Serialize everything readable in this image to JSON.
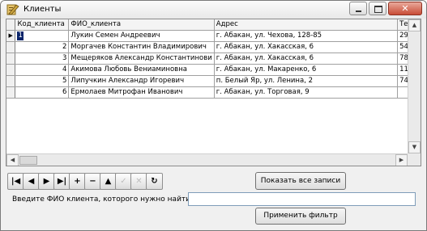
{
  "window": {
    "title": "Клиенты",
    "close_glyph": "✕"
  },
  "grid": {
    "current_pointer": "▶",
    "columns": [
      "Код_клиента",
      "ФИО_клиента",
      "Адрес",
      "Те"
    ],
    "rows": [
      {
        "id": "1",
        "name": "Лукин Семен Андреевич",
        "address": "г. Абакан, ул. Чехова, 128-85",
        "phone": "29"
      },
      {
        "id": "2",
        "name": "Моргачев Константин Владимирович",
        "address": "г. Абакан, ул. Хакасская, 6",
        "phone": "54"
      },
      {
        "id": "3",
        "name": "Мещеряков Александр Константинови",
        "address": "г. Абакан, ул. Хакасская, 6",
        "phone": "78"
      },
      {
        "id": "4",
        "name": "Акимова Любовь Вениаминовна",
        "address": "г. Абакан, ул. Макаренко, 6",
        "phone": "11"
      },
      {
        "id": "5",
        "name": "Липучкин Александр Игоревич",
        "address": "п. Белый Яр, ул. Ленина, 2",
        "phone": "74"
      },
      {
        "id": "6",
        "name": "Ермолаев Митрофан Иванович",
        "address": "г. Абакан, ул. Торговая, 9",
        "phone": ""
      }
    ]
  },
  "navigator": {
    "first": "|◀",
    "prior": "◀",
    "next": "▶",
    "last": "▶|",
    "insert": "+",
    "delete": "−",
    "edit": "▲",
    "post": "✓",
    "cancel": "✕",
    "refresh": "↻"
  },
  "filter": {
    "show_all_label": "Показать все записи",
    "search_label": "Введите ФИО клиента, которого нужно найти",
    "search_value": "",
    "apply_label": "Применить фильтр"
  }
}
